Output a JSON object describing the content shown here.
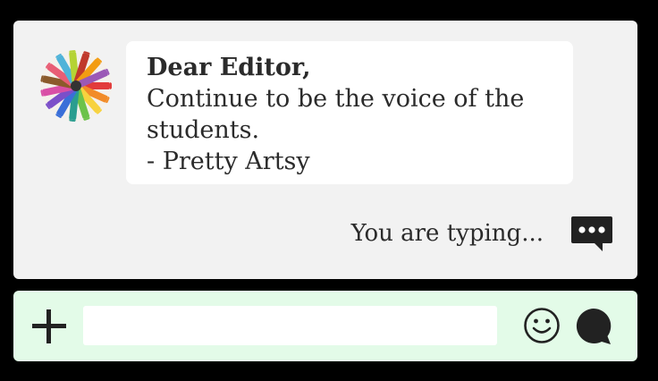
{
  "message": {
    "greeting": "Dear Editor,",
    "body": "Continue to be the voice of the students.",
    "signature": "- Pretty Artsy"
  },
  "status": {
    "typing_text": "You are typing..."
  },
  "composer": {
    "input_value": "",
    "input_placeholder": ""
  },
  "icons": {
    "avatar": "crayons-avatar",
    "typing": "speech-bubble-ellipsis-icon",
    "add": "plus-icon",
    "emoji": "smiley-icon",
    "send": "speech-bubble-icon"
  },
  "colors": {
    "page_background": "#000000",
    "chat_panel": "#f2f2f2",
    "message_bubble": "#ffffff",
    "composer_bar": "#e3fbe8",
    "text": "#2b2b2b",
    "icon": "#222222"
  }
}
